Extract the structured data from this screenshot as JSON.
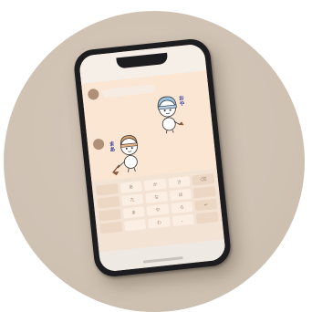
{
  "colors": {
    "background": "#d0c3b4",
    "phone_frame": "#1d1d1f",
    "chat_background": "#fbe6d3",
    "keyboard_background": "#f3e3d5",
    "avatar": "#b08f78"
  },
  "chat": {
    "received_sticker_text": "おや",
    "sent_sticker_text": "まあ"
  },
  "keyboard": {
    "keys": [
      "",
      "あ",
      "か",
      "さ",
      "⌫",
      "",
      "た",
      "な",
      "は",
      "",
      "",
      "ま",
      "や",
      "ら",
      "↵",
      "",
      "",
      "わ",
      "、",
      ""
    ]
  }
}
